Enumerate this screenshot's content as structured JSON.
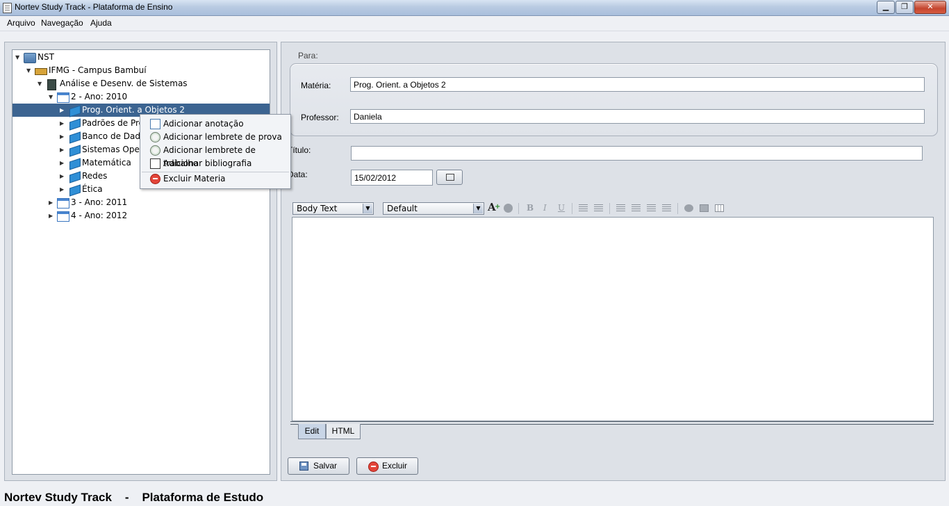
{
  "window": {
    "title": "Nortev Study Track - Plataforma de Ensino",
    "buttons": {
      "minimize": "▁",
      "maximize": "❐",
      "close": "✕"
    }
  },
  "menu": [
    "Arquivo",
    "Navegação",
    "Ajuda"
  ],
  "tree": [
    {
      "label": "NST",
      "icon": "folder-icon",
      "expanded": true
    },
    {
      "label": "IFMG - Campus Bambuí",
      "icon": "institution-icon",
      "expanded": true
    },
    {
      "label": "Análise e Desenv. de Sistemas",
      "icon": "course-icon",
      "expanded": true
    },
    {
      "label": "2 - Ano: 2010",
      "icon": "calendar-icon",
      "expanded": true
    },
    {
      "label": "Prog. Orient. a Objetos 2",
      "icon": "book-icon",
      "selected": true
    },
    {
      "label": "Padrões de Pro",
      "icon": "book-icon"
    },
    {
      "label": "Banco de Dado",
      "icon": "book-icon"
    },
    {
      "label": "Sistemas Oper",
      "icon": "book-icon"
    },
    {
      "label": "Matemática",
      "icon": "book-icon"
    },
    {
      "label": "Redes",
      "icon": "book-icon"
    },
    {
      "label": "Ética",
      "icon": "book-icon"
    },
    {
      "label": "3 - Ano: 2011",
      "icon": "calendar-icon"
    },
    {
      "label": "4 - Ano: 2012",
      "icon": "calendar-icon"
    }
  ],
  "context_menu": [
    {
      "label": "Adicionar anotação",
      "icon": "note-add-icon"
    },
    {
      "label": "Adicionar lembrete de prova",
      "icon": "clock-add-icon"
    },
    {
      "label": "Adicionar lembrete de trabalho",
      "icon": "clock-add-icon"
    },
    {
      "label": "Adicionar bibliografia",
      "icon": "bibliography-icon"
    },
    {
      "label": "Excluir Materia",
      "icon": "delete-icon"
    }
  ],
  "form": {
    "para_label": "Para:",
    "materia_label": "Matéria:",
    "materia_value": "Prog. Orient. a Objetos 2",
    "professor_label": "Professor:",
    "professor_value": "Daniela",
    "titulo_label": "Título:",
    "titulo_value": "",
    "data_label": "Data:",
    "data_value": "15/02/2012"
  },
  "editor": {
    "style_select": "Body Text",
    "font_select": "Default",
    "toolbar": {
      "bold": "B",
      "italic": "I",
      "underline": "U"
    },
    "content": "",
    "tabs": [
      "Edit",
      "HTML"
    ],
    "active_tab": "Edit"
  },
  "buttons": {
    "save": "Salvar",
    "delete": "Excluir"
  },
  "status": {
    "app": "Nortev Study Track",
    "separator": "-",
    "subtitle": "Plataforma de Estudo"
  },
  "colors": {
    "selection": "#3c6491",
    "panel": "#dde1e7",
    "delete": "#e3453a"
  }
}
